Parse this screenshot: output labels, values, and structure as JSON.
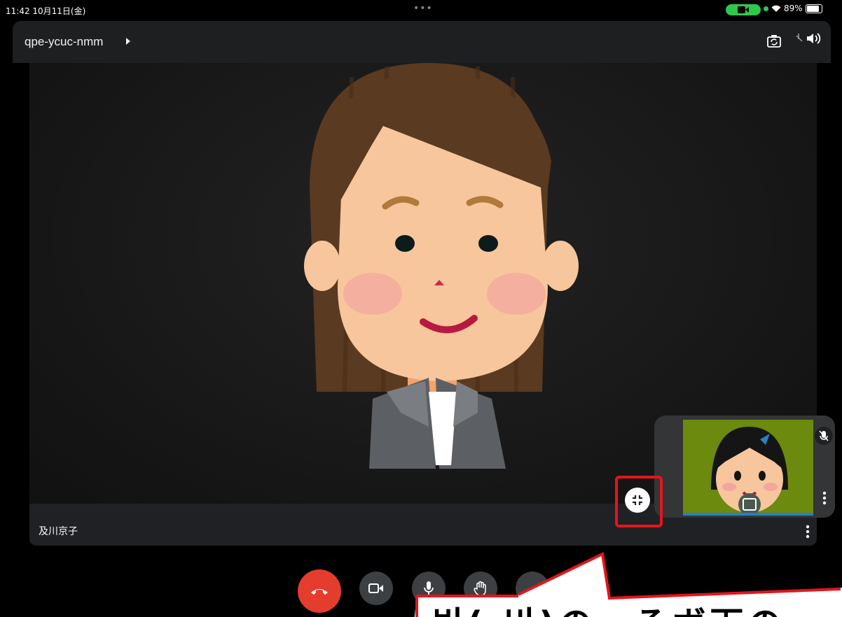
{
  "status_bar": {
    "time": "11:42  10月11日(金)",
    "dots": "•••",
    "battery_percent": "89%",
    "icons": [
      "camera-indicator-icon",
      "wifi-icon",
      "battery-icon"
    ]
  },
  "meeting": {
    "code": "qpe-ycuc-nmm",
    "icons": [
      "switch-camera-icon",
      "speaker-icon"
    ]
  },
  "main_video": {
    "participant_name": "及川京子"
  },
  "self_view": {
    "icons": [
      "mic-off-icon",
      "more-vert-icon",
      "portrait-icon"
    ]
  },
  "controls": {
    "icons": [
      "end-call-icon",
      "camera-icon",
      "mic-icon",
      "raise-hand-icon",
      "more-icon",
      "collapse-icon"
    ]
  },
  "callout": {
    "text": "빈(·비)の　るボ下の"
  },
  "colors": {
    "end_call": "#e43d2e",
    "highlight": "#e5141c",
    "status_green": "#2fc84b",
    "self_view_bg": "#6b8a0e"
  }
}
